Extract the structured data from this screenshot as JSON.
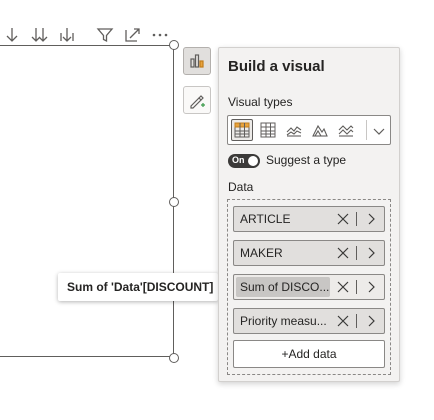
{
  "panel": {
    "title": "Build a visual",
    "visual_types_label": "Visual types",
    "visual_types": [
      {
        "icon": "matrix-icon",
        "selected": true
      },
      {
        "icon": "table-icon",
        "selected": false
      },
      {
        "icon": "line-chart-icon",
        "selected": false
      },
      {
        "icon": "area-chart-icon",
        "selected": false
      },
      {
        "icon": "stacked-area-icon",
        "selected": false
      }
    ],
    "suggest": {
      "toggle_text": "On",
      "label": "Suggest a type"
    },
    "data_label": "Data",
    "fields": [
      {
        "label": "ARTICLE"
      },
      {
        "label": "MAKER"
      },
      {
        "label": "Sum of DISCO..."
      },
      {
        "label": "Priority measu..."
      }
    ],
    "add_data_label": "+Add data"
  },
  "tooltip": {
    "text": "Sum of 'Data'[DISCOUNT]"
  },
  "colors": {
    "panel_bg": "#f3f2f1",
    "field_bg": "#e1dfdd",
    "toggle_bg": "#3b3a39",
    "border": "#8a8886"
  }
}
